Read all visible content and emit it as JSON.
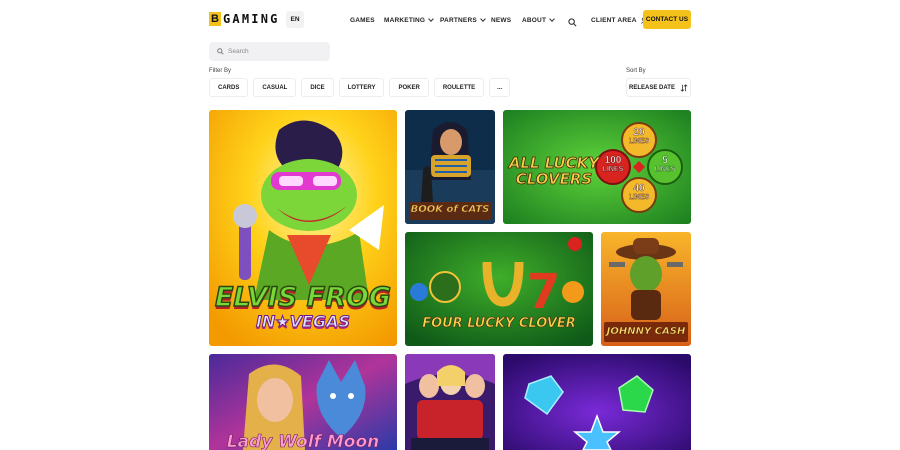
{
  "header": {
    "logo_letter": "B",
    "logo_text": "GAMING",
    "language": "EN",
    "nav": [
      {
        "label": "GAMES"
      },
      {
        "label": "MARKETING"
      },
      {
        "label": "PARTNERS"
      },
      {
        "label": "NEWS"
      },
      {
        "label": "ABOUT"
      }
    ],
    "client_area": "CLIENT AREA",
    "contact": "CONTACT US"
  },
  "search": {
    "placeholder": "Search"
  },
  "filter": {
    "label": "Filter By",
    "chips": [
      "CARDS",
      "CASUAL",
      "DICE",
      "LOTTERY",
      "POKER",
      "ROULETTE",
      "..."
    ]
  },
  "sort": {
    "label": "Sort By",
    "value": "RELEASE DATE"
  },
  "games": [
    {
      "title_line1": "ELVIS FROG",
      "title_line2": "IN★VEGAS"
    },
    {
      "title": "BOOK of CATS"
    },
    {
      "title_line1": "ALL LUCKY",
      "title_line2": "CLOVERS",
      "lines": [
        "20",
        "LINES",
        "100",
        "LINES",
        "5",
        "LINES",
        "40",
        "LINES"
      ]
    },
    {
      "title": "FOUR LUCKY CLOVER"
    },
    {
      "title": "JOHNNY CASH"
    },
    {
      "title": "Lady Wolf Moon"
    }
  ],
  "colors": {
    "accent": "#f5c21b",
    "text": "#1b1b1b",
    "chip_border": "#ededed",
    "search_bg": "#f1f1f3"
  }
}
